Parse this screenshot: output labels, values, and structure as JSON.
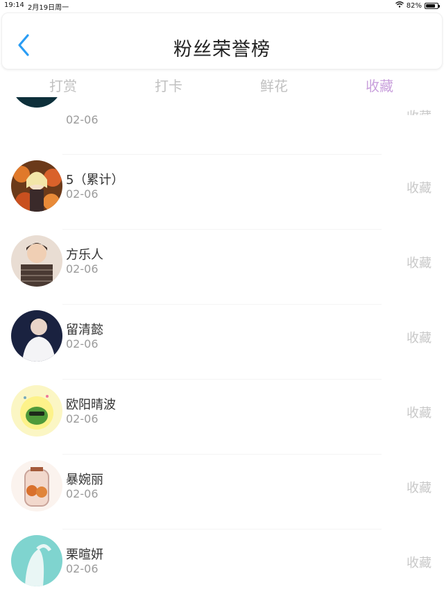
{
  "status_bar": {
    "time": "19:14",
    "date": "2月19日周一",
    "battery": "82%",
    "battery_level": 0.82
  },
  "header": {
    "title": "粉丝荣誉榜"
  },
  "tabs": [
    {
      "label": "打赏",
      "active": false
    },
    {
      "label": "打卡",
      "active": false
    },
    {
      "label": "鲜花",
      "active": false
    },
    {
      "label": "收藏",
      "active": true
    }
  ],
  "colors": {
    "accent_blue": "#2a9df4",
    "active_tab": "#c9a0dc",
    "inactive_tab": "#c0c0c0",
    "action_gray": "#c8c8c8"
  },
  "list": [
    {
      "name": "",
      "date": "02-06",
      "action": "收藏"
    },
    {
      "name": "5（累计）",
      "date": "02-06",
      "action": "收藏"
    },
    {
      "name": "方乐人",
      "date": "02-06",
      "action": "收藏"
    },
    {
      "name": "留清懿",
      "date": "02-06",
      "action": "收藏"
    },
    {
      "name": "欧阳晴波",
      "date": "02-06",
      "action": "收藏"
    },
    {
      "name": "暴婉丽",
      "date": "02-06",
      "action": "收藏"
    },
    {
      "name": "栗暄妍",
      "date": "02-06",
      "action": "收藏"
    }
  ]
}
